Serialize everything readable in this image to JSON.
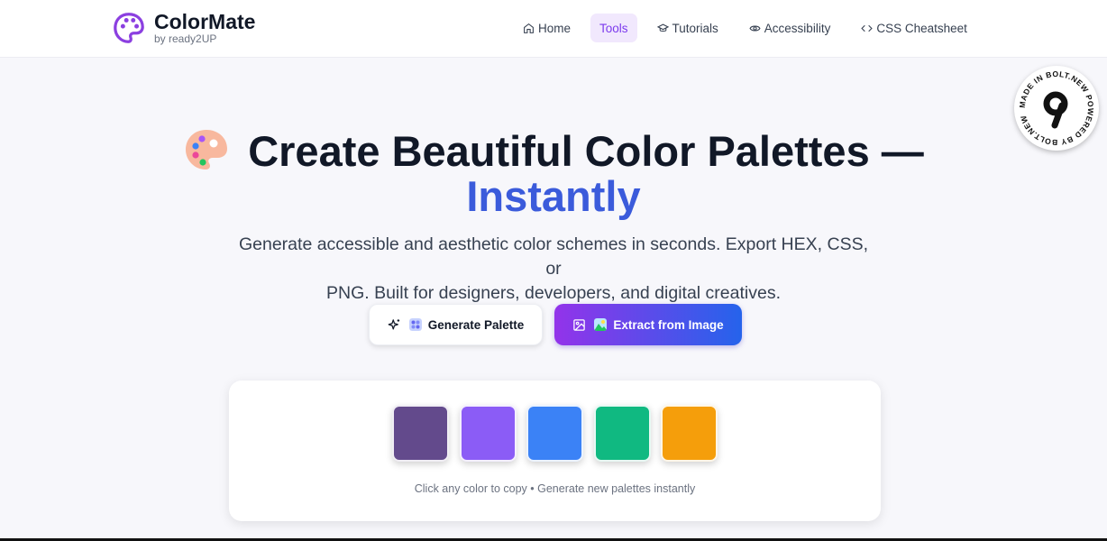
{
  "brand": {
    "name": "ColorMate",
    "subtitle": "by ready2UP",
    "accent": "#8b3fe0"
  },
  "nav": {
    "items": [
      {
        "label": "Home",
        "icon": "home-icon"
      },
      {
        "label": "Tools",
        "icon": "",
        "active": true
      },
      {
        "label": "Tutorials",
        "icon": "graduation-cap-icon"
      },
      {
        "label": "Accessibility",
        "icon": "eye-icon"
      },
      {
        "label": "CSS Cheatsheet",
        "icon": "code-icon"
      }
    ]
  },
  "badge": {
    "text": "MADE IN BOLT.NEW POWERED BY BOLT.NEW "
  },
  "hero": {
    "title_line1": "Create Beautiful Color Palettes —",
    "title_line2": "Instantly",
    "subtitle_line1": "Generate accessible and aesthetic color schemes in seconds. Export HEX, CSS, or",
    "subtitle_line2": "PNG. Built for designers, developers, and digital creatives."
  },
  "buttons": {
    "generate": "Generate Palette",
    "extract": "Extract from Image"
  },
  "palette": {
    "swatches": [
      "#634a8c",
      "#8b5cf6",
      "#3b82f6",
      "#10b981",
      "#f59e0b"
    ],
    "hint": "Click any color to copy • Generate new palettes instantly"
  },
  "colors": {
    "gradient_start": "#9333ea",
    "gradient_end": "#2563eb",
    "title_accent": "#3b5bdb"
  }
}
